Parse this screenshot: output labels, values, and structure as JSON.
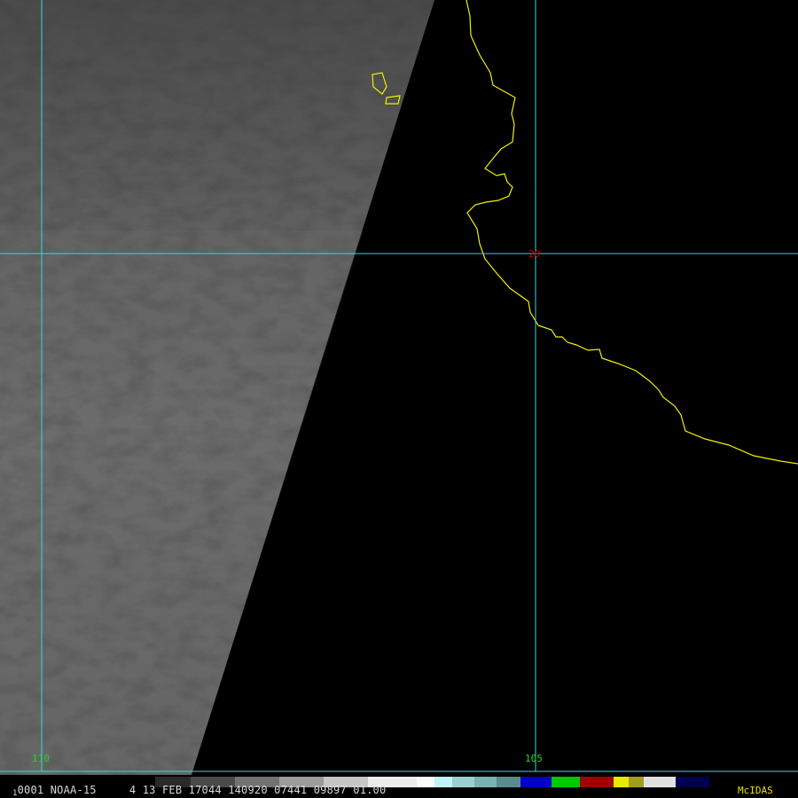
{
  "map": {
    "latitude_label": "20",
    "longitude_labels": {
      "west": "110",
      "east": "105"
    },
    "colors": {
      "graticule": "#34d8e0",
      "coastline": "#f0f000",
      "lat_label": "#c80000",
      "lon_label": "#2ad02a",
      "swath_gray": "#5d5d5d",
      "space": "#000000"
    }
  },
  "status_bar": {
    "frame": "1",
    "info": "0001 NOAA-15     4 13 FEB 17044 140920 07441 09897 01.00",
    "brand": "McIDAS"
  }
}
